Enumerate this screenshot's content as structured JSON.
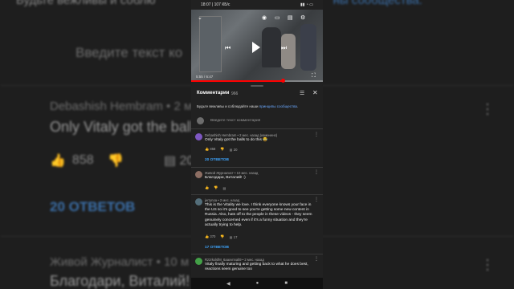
{
  "background": {
    "top_text": "Будьте вежливы и соблю",
    "top_link": "ны сообщества.",
    "placeholder": "Введите текст ко",
    "c1_author": "Debashish Hembram • 2 м",
    "c1_text": "Only Vitaly got the ball",
    "c1_likes": "858",
    "c1_reply_count": "20",
    "replies": "20 ОТВЕТОВ",
    "c2_author": "Живой Журналист • 10 м",
    "c2_text": "Благодари, Виталий!"
  },
  "status_bar": {
    "time": "18:07",
    "speed": "107 КБ/с"
  },
  "video": {
    "timecode": "5:55 / 6:47",
    "progress": 0.7
  },
  "comments_panel": {
    "title": "Комментарии",
    "count": "966",
    "rules_text": "Будьте вежливы и соблюдайте наши ",
    "rules_link": "принципы сообщества",
    "rules_end": ".",
    "input_placeholder": "Введите текст комментария",
    "comments": [
      {
        "author": "Debashish Hembram • 2 мес. назад (изменено)",
        "text": "Only Vitaly got the balls to do this 😂",
        "likes": "858",
        "replies_count": "20",
        "replies_label": "20 ОТВЕТОВ",
        "avatar_color": "#7e57c2"
      },
      {
        "author": "Живой Журналист • 10 мес. назад",
        "text": "Благодари, Виталий! :)",
        "likes": "",
        "replies_count": "",
        "replies_label": "",
        "avatar_color": "#8d6e63"
      },
      {
        "author": "jerrynoa • 2 мес. назад",
        "text": "This is the Vitality we love. I think everyone knows your face in the US so it's good to see you're getting some new content in Russia. Also, hats off to the people in these videos - they seem genuinely concerned even if it's a funny situation and they're actually trying to help.",
        "likes": "370",
        "replies_count": "17",
        "replies_label": "17 ОТВЕТОВ",
        "avatar_color": "#546e7a"
      },
      {
        "author": "Rz2rkxlsfM_6aaxvnnalt9 • 2 мес. назад",
        "text": "Vitaly finally maturing and getting back to what he does best, reactions seem genuine too",
        "likes": "",
        "replies_count": "",
        "replies_label": "",
        "avatar_color": "#43a047"
      }
    ]
  },
  "colors": {
    "accent_link": "#3ea6ff",
    "progress": "#ff0000"
  }
}
